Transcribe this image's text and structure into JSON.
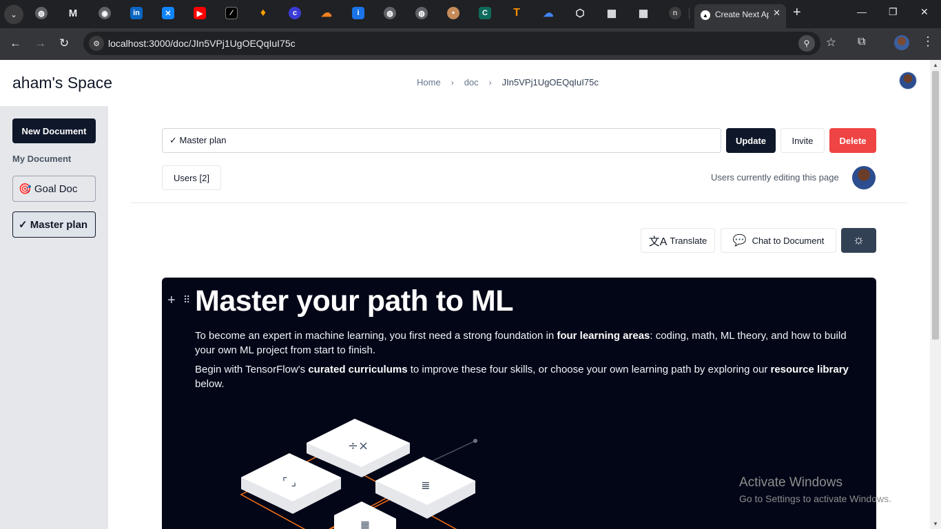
{
  "browser": {
    "active_tab_title": "Create Next App",
    "tab_close": "✕",
    "new_tab": "+",
    "url": "localhost:3000/doc/JIn5VPj1UgOEQqIuI75c",
    "pinned_tabs": [
      "globe",
      "gmail",
      "chat",
      "linkedin",
      "bluesky",
      "youtube",
      "notion-like",
      "firebase",
      "c-app",
      "cloudflare",
      "info",
      "globe",
      "globe",
      "cookie",
      "c-green",
      "tensorflow",
      "google-cloud",
      "box",
      "grid",
      "grid",
      "n-app"
    ]
  },
  "header": {
    "space_title": "aham's Space",
    "breadcrumb": [
      "Home",
      "doc",
      "JIn5VPj1UgOEQqIuI75c"
    ]
  },
  "sidebar": {
    "new_document": "New Document",
    "section_label": "My Document",
    "items": [
      {
        "label": "🎯 Goal Doc"
      },
      {
        "label": "✓ Master plan"
      }
    ]
  },
  "main": {
    "title_value": "✓ Master plan",
    "update": "Update",
    "invite": "Invite",
    "delete": "Delete",
    "users": "Users [2]",
    "editing_text": "Users currently editing this page",
    "translate": "Translate",
    "chat": "Chat to Document"
  },
  "editor": {
    "heading": "Master your path to ML",
    "p1_a": "To become an expert in machine learning, you first need a strong foundation in ",
    "p1_b": "four learning areas",
    "p1_c": ": coding, math, ML theory, and how to build your own ML project from start to finish.",
    "p2_a": "Begin with TensorFlow's ",
    "p2_b": "curated curriculums",
    "p2_c": " to improve these four skills, or choose your own learning path by exploring our ",
    "p2_d": "resource library",
    "p2_e": " below."
  },
  "windows_watermark": {
    "line1": "Activate Windows",
    "line2": "Go to Settings to activate Windows."
  },
  "colors": {
    "primary_dark": "#0f172a",
    "delete_red": "#ef4444",
    "editor_bg": "#020617",
    "sidebar_bg": "#e5e7eb",
    "puzzle_accent": "#f97316"
  }
}
